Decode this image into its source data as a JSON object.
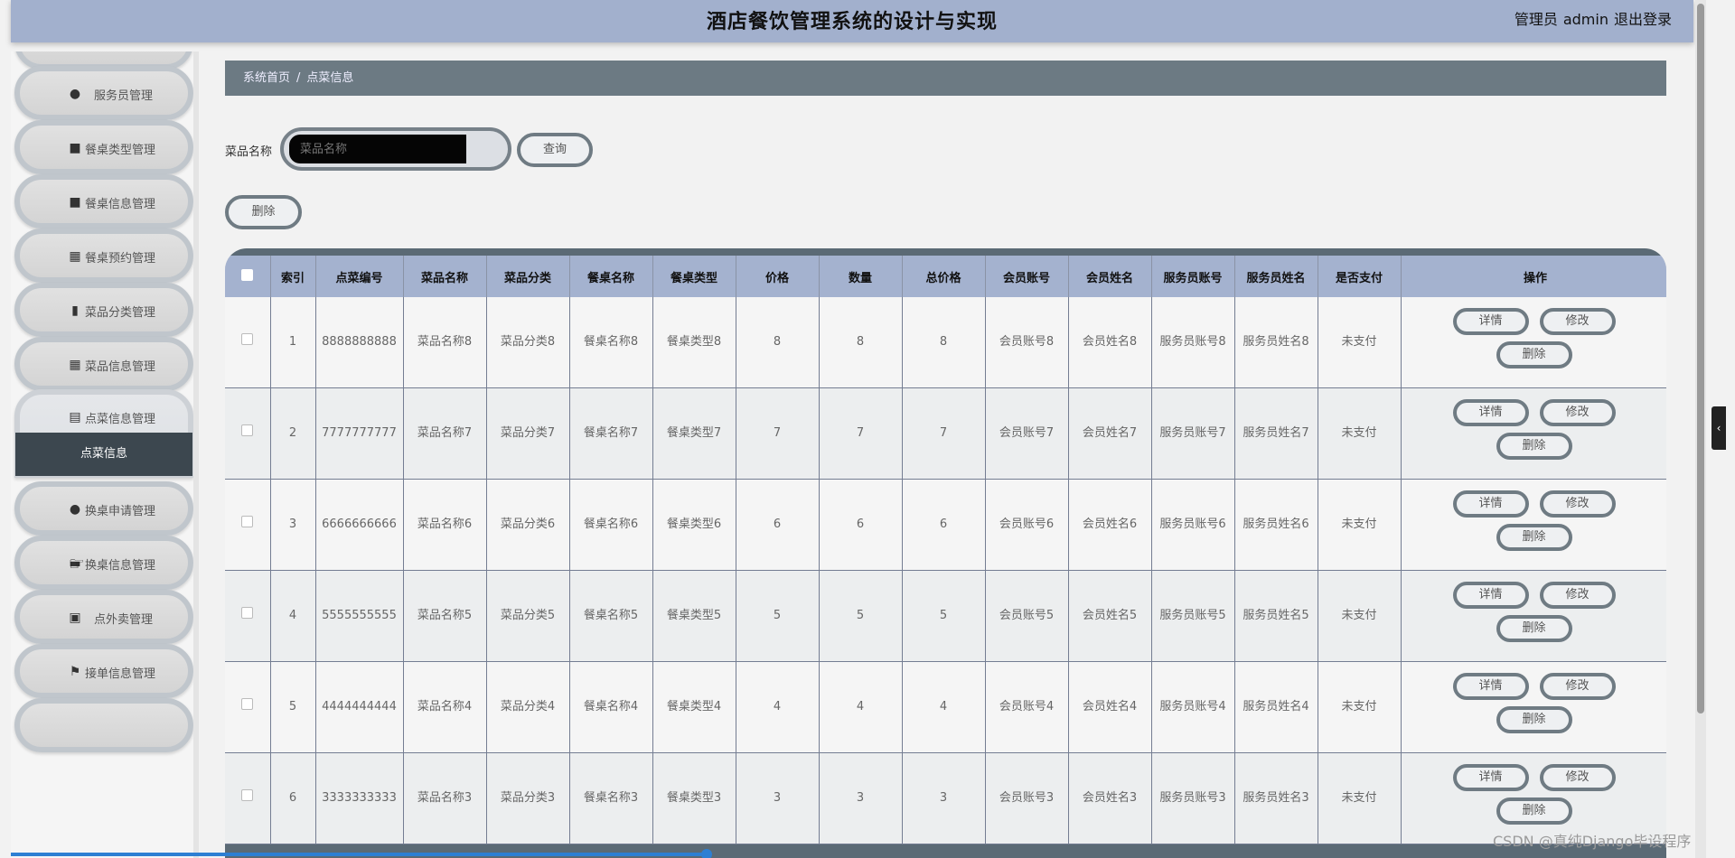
{
  "header": {
    "title": "酒店餐饮管理系统的设计与实现",
    "role": "管理员",
    "user": "admin",
    "logout": "退出登录"
  },
  "sidebar": {
    "items": [
      {
        "label": "服务员管理",
        "icon": "user-icon"
      },
      {
        "label": "餐桌类型管理",
        "icon": "table-icon"
      },
      {
        "label": "餐桌信息管理",
        "icon": "table-icon"
      },
      {
        "label": "餐桌预约管理",
        "icon": "grid-icon"
      },
      {
        "label": "菜品分类管理",
        "icon": "clipboard-icon"
      },
      {
        "label": "菜品信息管理",
        "icon": "grid-icon"
      },
      {
        "label": "点菜信息管理",
        "icon": "bar-chart-icon"
      },
      {
        "label": "换桌申请管理",
        "icon": "user-icon"
      },
      {
        "label": "换桌信息管理",
        "icon": "monitor-icon"
      },
      {
        "label": "点外卖管理",
        "icon": "ticket-icon"
      },
      {
        "label": "接单信息管理",
        "icon": "flag-icon"
      }
    ],
    "submenu": "点菜信息"
  },
  "breadcrumb": {
    "home": "系统首页",
    "sep": "/",
    "current": "点菜信息"
  },
  "search": {
    "label": "菜品名称",
    "placeholder": "菜品名称",
    "query": "查询"
  },
  "actions": {
    "delete": "删除"
  },
  "table": {
    "headers": [
      "索引",
      "点菜编号",
      "菜品名称",
      "菜品分类",
      "餐桌名称",
      "餐桌类型",
      "价格",
      "数量",
      "总价格",
      "会员账号",
      "会员姓名",
      "服务员账号",
      "服务员姓名",
      "是否支付",
      "操作"
    ],
    "ops": {
      "detail": "详情",
      "edit": "修改",
      "delete": "删除"
    },
    "rows": [
      [
        "1",
        "8888888888",
        "菜品名称8",
        "菜品分类8",
        "餐桌名称8",
        "餐桌类型8",
        "8",
        "8",
        "8",
        "会员账号8",
        "会员姓名8",
        "服务员账号8",
        "服务员姓名8",
        "未支付"
      ],
      [
        "2",
        "7777777777",
        "菜品名称7",
        "菜品分类7",
        "餐桌名称7",
        "餐桌类型7",
        "7",
        "7",
        "7",
        "会员账号7",
        "会员姓名7",
        "服务员账号7",
        "服务员姓名7",
        "未支付"
      ],
      [
        "3",
        "6666666666",
        "菜品名称6",
        "菜品分类6",
        "餐桌名称6",
        "餐桌类型6",
        "6",
        "6",
        "6",
        "会员账号6",
        "会员姓名6",
        "服务员账号6",
        "服务员姓名6",
        "未支付"
      ],
      [
        "4",
        "5555555555",
        "菜品名称5",
        "菜品分类5",
        "餐桌名称5",
        "餐桌类型5",
        "5",
        "5",
        "5",
        "会员账号5",
        "会员姓名5",
        "服务员账号5",
        "服务员姓名5",
        "未支付"
      ],
      [
        "5",
        "4444444444",
        "菜品名称4",
        "菜品分类4",
        "餐桌名称4",
        "餐桌类型4",
        "4",
        "4",
        "4",
        "会员账号4",
        "会员姓名4",
        "服务员账号4",
        "服务员姓名4",
        "未支付"
      ],
      [
        "6",
        "3333333333",
        "菜品名称3",
        "菜品分类3",
        "餐桌名称3",
        "餐桌类型3",
        "3",
        "3",
        "3",
        "会员账号3",
        "会员姓名3",
        "服务员账号3",
        "服务员姓名3",
        "未支付"
      ]
    ]
  },
  "watermark": "CSDN @真纯Django毕设程序",
  "colors": {
    "header": "#a2b0cd",
    "crumb": "#6c7a83",
    "submenu": "#3c474f",
    "th": "#a4b2cf"
  }
}
